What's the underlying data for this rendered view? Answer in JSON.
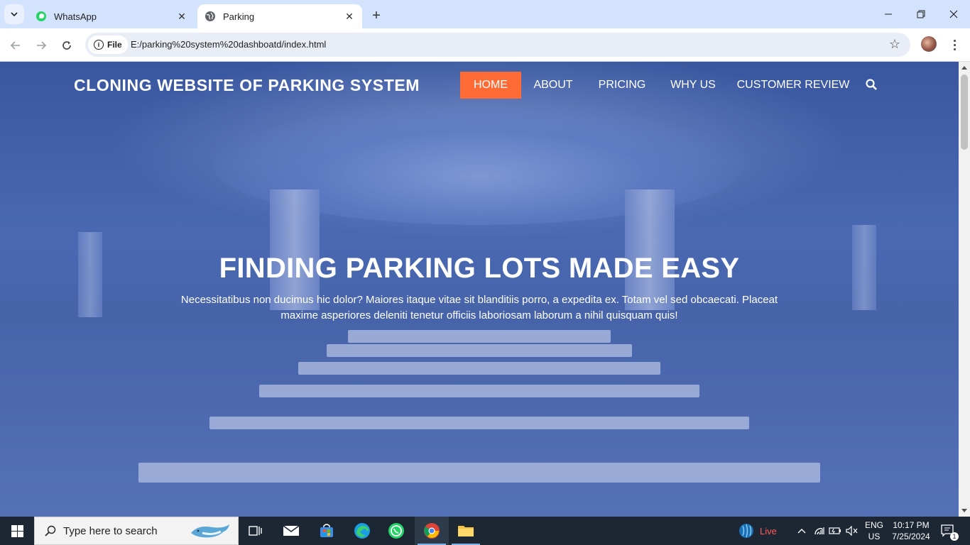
{
  "browser": {
    "tabs": [
      {
        "title": "WhatsApp",
        "icon": "whatsapp-icon",
        "active": false
      },
      {
        "title": "Parking",
        "icon": "globe-icon",
        "active": true
      }
    ],
    "address": {
      "scheme_chip": "File",
      "url": "E:/parking%20system%20dashboatd/index.html"
    }
  },
  "page": {
    "brand": "CLONING WEBSITE OF PARKING SYSTEM",
    "nav": [
      "HOME",
      "ABOUT",
      "PRICING",
      "WHY US",
      "CUSTOMER REVIEW"
    ],
    "active_nav": "HOME",
    "accent_color": "#ff6b35",
    "hero": {
      "title": "FINDING PARKING LOTS MADE EASY",
      "text_line1": "Necessitatibus non ducimus hic dolor? Maiores itaque vitae sit blanditiis porro, a expedita ex. Totam vel sed obcaecati. Placeat",
      "text_line2": "maxime asperiores deleniti tenetur officiis laboriosam laborum a nihil quisquam quis!"
    }
  },
  "taskbar": {
    "search_placeholder": "Type here to search",
    "live_label": "Live",
    "language": "ENG",
    "region": "US",
    "time": "10:17 PM",
    "date": "7/25/2024",
    "notification_count": "1"
  }
}
